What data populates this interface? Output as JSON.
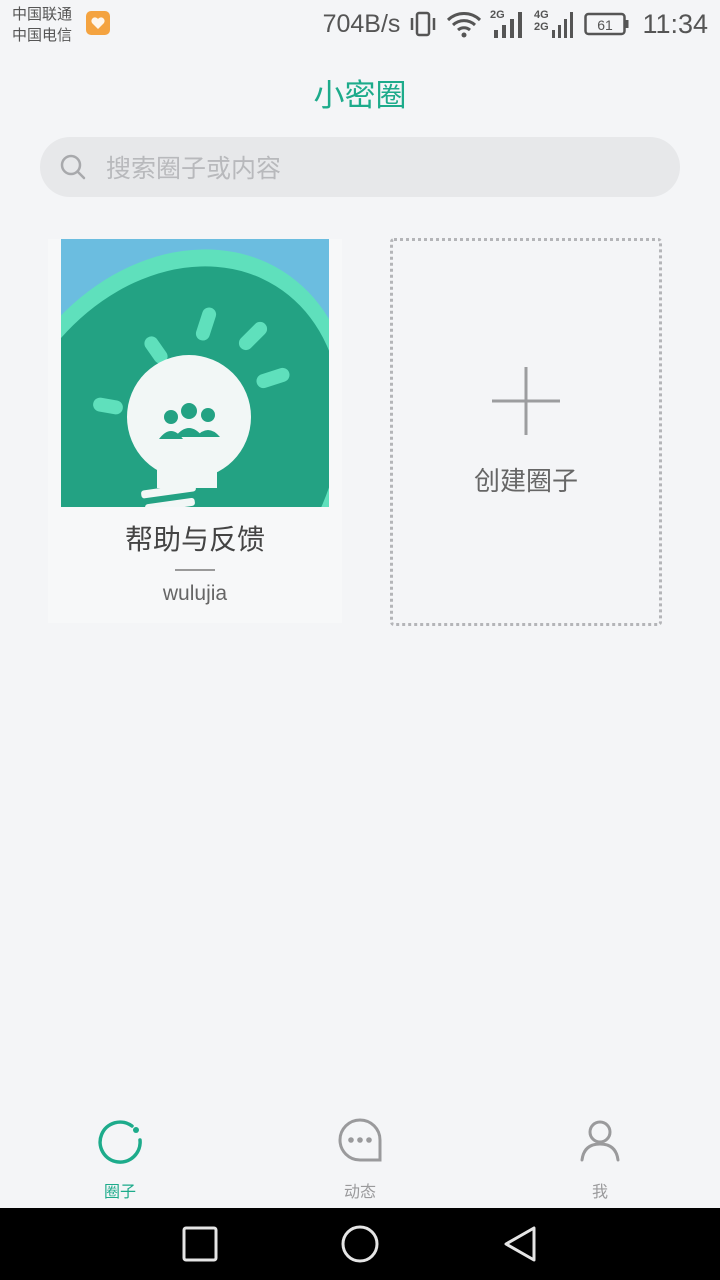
{
  "status_bar": {
    "carrier_1": "中国联通",
    "carrier_2": "中国电信",
    "net_speed": "704B/s",
    "network_2g": "2G",
    "network_4g": "4G",
    "network_2g_b": "2G",
    "battery": "61",
    "time": "11:34",
    "icons": [
      "app-notification-icon",
      "vibrate-icon",
      "wifi-icon",
      "signal-icon",
      "signal-icon",
      "battery-icon"
    ]
  },
  "header": {
    "title": "小密圈"
  },
  "search": {
    "placeholder": "搜索圈子或内容"
  },
  "circles": [
    {
      "name": "帮助与反馈",
      "owner": "wulujia",
      "cover_icon": "lightbulb-icon"
    }
  ],
  "create_card": {
    "label": "创建圈子"
  },
  "tabs": [
    {
      "label": "圈子",
      "icon": "circle-refresh-icon",
      "active": true
    },
    {
      "label": "动态",
      "icon": "chat-bubble-icon",
      "active": false
    },
    {
      "label": "我",
      "icon": "person-icon",
      "active": false
    }
  ],
  "colors": {
    "accent": "#1dab8b",
    "background": "#f4f5f7",
    "cover_sky": "#6bbde0",
    "cover_green": "#23a283",
    "cover_ring": "#5fe0bc"
  }
}
